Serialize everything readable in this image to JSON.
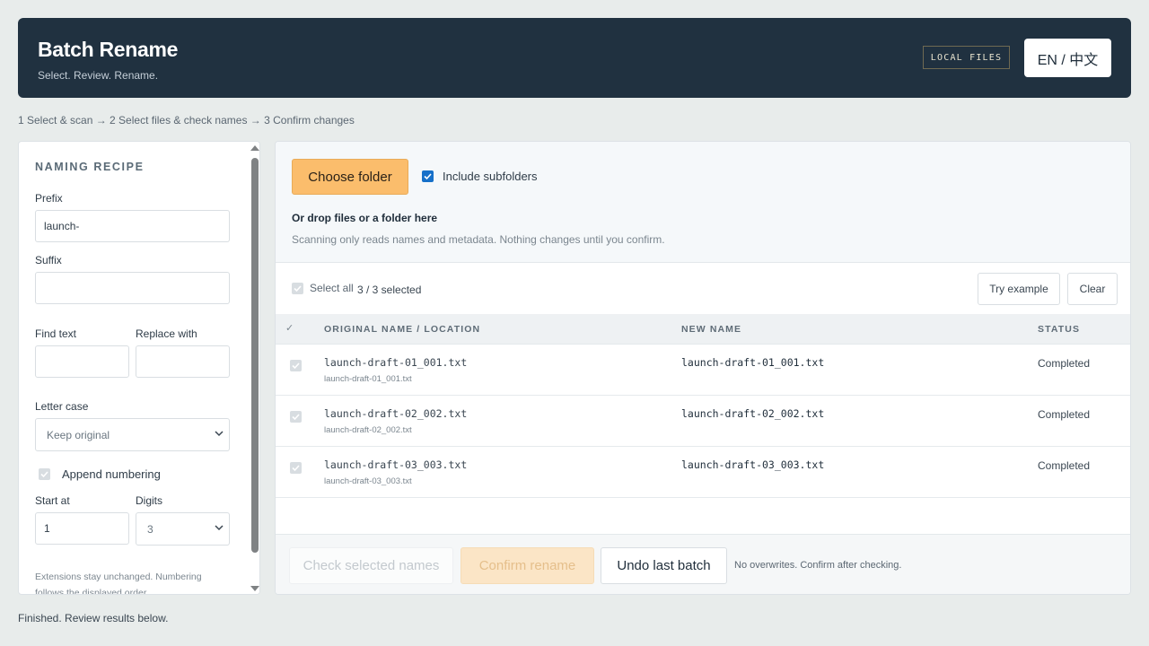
{
  "header": {
    "title": "Batch Rename",
    "subtitle": "Select. Review. Rename.",
    "badge": "LOCAL FILES",
    "language": "EN / 中文"
  },
  "steps": "1 Select & scan → 2 Select files & check names → 3 Confirm changes",
  "recipe": {
    "title": "NAMING RECIPE",
    "prefix_label": "Prefix",
    "prefix_value": "launch-",
    "suffix_label": "Suffix",
    "suffix_value": "",
    "find_label": "Find text",
    "find_value": "",
    "replace_label": "Replace with",
    "replace_value": "",
    "case_label": "Letter case",
    "case_value": "Keep original",
    "append_label": "Append numbering",
    "append_checked": true,
    "start_label": "Start at",
    "start_value": "1",
    "digits_label": "Digits",
    "digits_value": "3",
    "note": "Extensions stay unchanged. Numbering follows the displayed order."
  },
  "dropzone": {
    "choose_label": "Choose folder",
    "subfolders_label": "Include subfolders",
    "subfolders_checked": true,
    "title": "Or drop files or a folder here",
    "subtitle": "Scanning only reads names and metadata. Nothing changes until you confirm."
  },
  "selection": {
    "select_all_label": "Select all",
    "count": "3 / 3 selected",
    "try_label": "Try example",
    "clear_label": "Clear"
  },
  "table": {
    "check_header": "✓",
    "headers": [
      "ORIGINAL NAME / LOCATION",
      "NEW NAME",
      "STATUS"
    ],
    "rows": [
      {
        "original": "launch-draft-01_001.txt",
        "location": "launch-draft-01_001.txt",
        "new": "launch-draft-01_001.txt",
        "status": "Completed"
      },
      {
        "original": "launch-draft-02_002.txt",
        "location": "launch-draft-02_002.txt",
        "new": "launch-draft-02_002.txt",
        "status": "Completed"
      },
      {
        "original": "launch-draft-03_003.txt",
        "location": "launch-draft-03_003.txt",
        "new": "launch-draft-03_003.txt",
        "status": "Completed"
      }
    ]
  },
  "footer": {
    "check_label": "Check selected names",
    "confirm_label": "Confirm rename",
    "undo_label": "Undo last batch",
    "note": "No overwrites. Confirm after checking."
  },
  "status_line": "Finished. Review results below.",
  "colors": {
    "header_bg": "#203140",
    "accent": "#fbbd6c",
    "checkbox": "#1670c9",
    "page_bg": "#e8eceb"
  },
  "icons": {
    "select_chevron": "chevron-down-icon",
    "checkmark": "check-icon"
  }
}
